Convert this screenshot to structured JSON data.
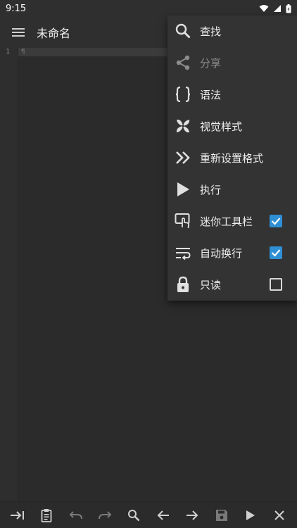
{
  "status_bar": {
    "time": "9:15"
  },
  "app_bar": {
    "title": "未命名"
  },
  "editor": {
    "line_number": "1",
    "pilcrow": "¶"
  },
  "menu": {
    "items": [
      {
        "label": "查找",
        "icon": "search-icon",
        "enabled": true
      },
      {
        "label": "分享",
        "icon": "share-icon",
        "enabled": false
      },
      {
        "label": "语法",
        "icon": "braces-icon",
        "enabled": true
      },
      {
        "label": "视觉样式",
        "icon": "pinwheel-icon",
        "enabled": true
      },
      {
        "label": "重新设置格式",
        "icon": "double-chevron-right-icon",
        "enabled": true
      },
      {
        "label": "执行",
        "icon": "play-icon",
        "enabled": true
      },
      {
        "label": "迷你工具栏",
        "icon": "touch-toolbar-icon",
        "checkbox": true,
        "checked": true
      },
      {
        "label": "自动换行",
        "icon": "wrap-text-icon",
        "checkbox": true,
        "checked": true
      },
      {
        "label": "只读",
        "icon": "lock-icon",
        "checkbox": true,
        "checked": false
      }
    ]
  },
  "bottom_toolbar": {
    "tools": [
      "tab-icon",
      "paste-icon",
      "undo-icon",
      "redo-icon",
      "search-icon",
      "arrow-left-icon",
      "arrow-right-icon",
      "save-icon",
      "play-icon",
      "close-icon"
    ]
  },
  "colors": {
    "background": "#2b2b2b",
    "menu_background": "#333333",
    "accent_checkbox": "#2f8fd4"
  }
}
